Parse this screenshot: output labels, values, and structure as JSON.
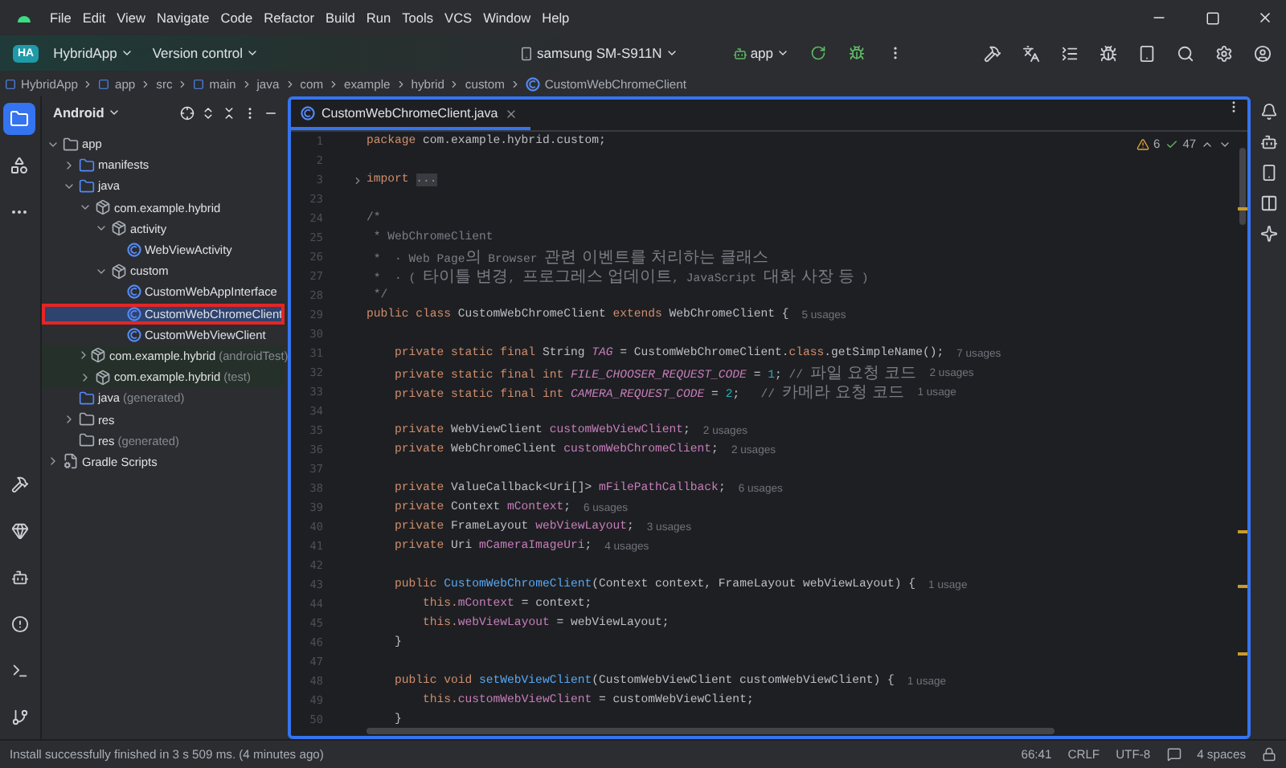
{
  "menu": [
    "File",
    "Edit",
    "View",
    "Navigate",
    "Code",
    "Refactor",
    "Build",
    "Run",
    "Tools",
    "VCS",
    "Window",
    "Help"
  ],
  "project": {
    "badge": "HA",
    "name": "HybridApp"
  },
  "version_control": "Version control",
  "device": "samsung SM-S911N",
  "run_config": "app",
  "breadcrumbs": [
    {
      "label": "HybridApp",
      "kind": "module"
    },
    {
      "label": "app",
      "kind": "module"
    },
    {
      "label": "src",
      "kind": "dir"
    },
    {
      "label": "main",
      "kind": "module"
    },
    {
      "label": "java",
      "kind": "dir"
    },
    {
      "label": "com",
      "kind": "dir"
    },
    {
      "label": "example",
      "kind": "dir"
    },
    {
      "label": "hybrid",
      "kind": "dir"
    },
    {
      "label": "custom",
      "kind": "dir"
    },
    {
      "label": "CustomWebChromeClient",
      "kind": "class"
    }
  ],
  "project_panel": {
    "view": "Android",
    "tree": [
      {
        "label": "app",
        "kind": "module",
        "expanded": true,
        "selected": false,
        "children": [
          {
            "label": "manifests",
            "kind": "folder",
            "expanded": false,
            "selected": false
          },
          {
            "label": "java",
            "kind": "folder",
            "expanded": true,
            "selected": false,
            "children": [
              {
                "label": "com.example.hybrid",
                "kind": "package",
                "expanded": true,
                "selected": false,
                "children": [
                  {
                    "label": "activity",
                    "kind": "package",
                    "expanded": true,
                    "selected": false,
                    "children": [
                      {
                        "label": "WebViewActivity",
                        "kind": "class",
                        "selected": false
                      }
                    ]
                  },
                  {
                    "label": "custom",
                    "kind": "package",
                    "expanded": true,
                    "selected": false,
                    "children": [
                      {
                        "label": "CustomWebAppInterface",
                        "kind": "class",
                        "selected": false
                      },
                      {
                        "label": "CustomWebChromeClient",
                        "kind": "class",
                        "selected": true
                      },
                      {
                        "label": "CustomWebViewClient",
                        "kind": "class",
                        "selected": false
                      }
                    ]
                  }
                ]
              },
              {
                "label": "com.example.hybrid",
                "suffix": "(androidTest)",
                "kind": "test-package",
                "expanded": false,
                "selected": false
              },
              {
                "label": "com.example.hybrid",
                "suffix": "(test)",
                "kind": "test-package",
                "expanded": false,
                "selected": false
              }
            ]
          },
          {
            "label": "java",
            "suffix": "(generated)",
            "kind": "generated",
            "selected": false
          },
          {
            "label": "res",
            "kind": "res",
            "expanded": false,
            "selected": false
          },
          {
            "label": "res",
            "suffix": "(generated)",
            "kind": "res",
            "selected": false
          }
        ]
      },
      {
        "label": "Gradle Scripts",
        "kind": "gradle",
        "expanded": false,
        "selected": false
      }
    ]
  },
  "editor": {
    "tab": {
      "label": "CustomWebChromeClient.java",
      "selected": true
    },
    "warnings": "6",
    "checks": "47",
    "lines": [
      {
        "number": "1",
        "tokens": [
          {
            "kind": "kw",
            "text": "package"
          },
          {
            "kind": "plain",
            "text": " com.example.hybrid.custom;"
          }
        ]
      },
      {
        "number": "2"
      },
      {
        "number": "3",
        "folded": true,
        "tokens": [
          {
            "kind": "kw",
            "text": "import "
          },
          {
            "kind": "fold",
            "text": "..."
          }
        ]
      },
      {
        "number": "23"
      },
      {
        "number": "24",
        "tokens": [
          {
            "kind": "comment",
            "text": "/*"
          }
        ]
      },
      {
        "number": "25",
        "tokens": [
          {
            "kind": "comment",
            "text": " * WebChromeClient"
          }
        ]
      },
      {
        "number": "26",
        "tokens": [
          {
            "kind": "comment",
            "text": " *  · Web Page의 Browser 관련 이벤트를 처리하는 클래스"
          }
        ]
      },
      {
        "number": "27",
        "tokens": [
          {
            "kind": "comment",
            "text": " *  · ( 타이틀 변경, 프로그레스 업데이트, JavaScript 대화 사장 등 )"
          }
        ]
      },
      {
        "number": "28",
        "tokens": [
          {
            "kind": "comment",
            "text": " */"
          }
        ]
      },
      {
        "number": "29",
        "tokens": [
          {
            "kind": "kw",
            "text": "public class "
          },
          {
            "kind": "plain",
            "text": "CustomWebChromeClient "
          },
          {
            "kind": "kw",
            "text": "extends "
          },
          {
            "kind": "plain",
            "text": "WebChromeClient {"
          }
        ],
        "hint": "5 usages"
      },
      {
        "number": "30"
      },
      {
        "number": "31",
        "tokens": [
          {
            "kind": "kw",
            "text": "    private static final "
          },
          {
            "kind": "plain",
            "text": "String "
          },
          {
            "kind": "const",
            "text": "TAG"
          },
          {
            "kind": "plain",
            "text": " = CustomWebChromeClient."
          },
          {
            "kind": "kw",
            "text": "class"
          },
          {
            "kind": "plain",
            "text": ".getSimpleName();"
          }
        ],
        "hint": "7 usages"
      },
      {
        "number": "32",
        "tokens": [
          {
            "kind": "kw",
            "text": "    private static final int "
          },
          {
            "kind": "const",
            "text": "FILE_CHOOSER_REQUEST_CODE"
          },
          {
            "kind": "plain",
            "text": " = "
          },
          {
            "kind": "num",
            "text": "1"
          },
          {
            "kind": "plain",
            "text": "; "
          },
          {
            "kind": "comment",
            "text": "// 파일 요청 코드"
          }
        ],
        "hint": "2 usages"
      },
      {
        "number": "33",
        "tokens": [
          {
            "kind": "kw",
            "text": "    private static final int "
          },
          {
            "kind": "const",
            "text": "CAMERA_REQUEST_CODE"
          },
          {
            "kind": "plain",
            "text": " = "
          },
          {
            "kind": "num",
            "text": "2"
          },
          {
            "kind": "plain",
            "text": ";   "
          },
          {
            "kind": "comment",
            "text": "// 카메라 요청 코드"
          }
        ],
        "hint": "1 usage"
      },
      {
        "number": "34"
      },
      {
        "number": "35",
        "tokens": [
          {
            "kind": "kw",
            "text": "    private "
          },
          {
            "kind": "plain",
            "text": "WebViewClient "
          },
          {
            "kind": "field",
            "text": "customWebViewClient"
          },
          {
            "kind": "plain",
            "text": ";"
          }
        ],
        "hint": "2 usages"
      },
      {
        "number": "36",
        "tokens": [
          {
            "kind": "kw",
            "text": "    private "
          },
          {
            "kind": "plain",
            "text": "WebChromeClient "
          },
          {
            "kind": "field",
            "text": "customWebChromeClient"
          },
          {
            "kind": "plain",
            "text": ";"
          }
        ],
        "hint": "2 usages"
      },
      {
        "number": "37"
      },
      {
        "number": "38",
        "tokens": [
          {
            "kind": "kw",
            "text": "    private "
          },
          {
            "kind": "plain",
            "text": "ValueCallback<Uri[]> "
          },
          {
            "kind": "field",
            "text": "mFilePathCallback"
          },
          {
            "kind": "plain",
            "text": ";"
          }
        ],
        "hint": "6 usages"
      },
      {
        "number": "39",
        "tokens": [
          {
            "kind": "kw",
            "text": "    private "
          },
          {
            "kind": "plain",
            "text": "Context "
          },
          {
            "kind": "field",
            "text": "mContext"
          },
          {
            "kind": "plain",
            "text": ";"
          }
        ],
        "hint": "6 usages"
      },
      {
        "number": "40",
        "tokens": [
          {
            "kind": "kw",
            "text": "    private "
          },
          {
            "kind": "plain",
            "text": "FrameLayout "
          },
          {
            "kind": "field",
            "text": "webViewLayout"
          },
          {
            "kind": "plain",
            "text": ";"
          }
        ],
        "hint": "3 usages"
      },
      {
        "number": "41",
        "tokens": [
          {
            "kind": "kw",
            "text": "    private "
          },
          {
            "kind": "plain",
            "text": "Uri "
          },
          {
            "kind": "field",
            "text": "mCameraImageUri"
          },
          {
            "kind": "plain",
            "text": ";"
          }
        ],
        "hint": "4 usages"
      },
      {
        "number": "42"
      },
      {
        "number": "43",
        "tokens": [
          {
            "kind": "kw",
            "text": "    public "
          },
          {
            "kind": "fn",
            "text": "CustomWebChromeClient"
          },
          {
            "kind": "plain",
            "text": "(Context context, FrameLayout webViewLayout) {"
          }
        ],
        "hint": "1 usage"
      },
      {
        "number": "44",
        "tokens": [
          {
            "kind": "kw",
            "text": "        this."
          },
          {
            "kind": "field",
            "text": "mContext"
          },
          {
            "kind": "plain",
            "text": " = context;"
          }
        ]
      },
      {
        "number": "45",
        "tokens": [
          {
            "kind": "kw",
            "text": "        this."
          },
          {
            "kind": "field",
            "text": "webViewLayout"
          },
          {
            "kind": "plain",
            "text": " = webViewLayout;"
          }
        ]
      },
      {
        "number": "46",
        "tokens": [
          {
            "kind": "plain",
            "text": "    }"
          }
        ]
      },
      {
        "number": "47"
      },
      {
        "number": "48",
        "tokens": [
          {
            "kind": "kw",
            "text": "    public void "
          },
          {
            "kind": "fn",
            "text": "setWebViewClient"
          },
          {
            "kind": "plain",
            "text": "(CustomWebViewClient customWebViewClient) {"
          }
        ],
        "hint": "1 usage"
      },
      {
        "number": "49",
        "tokens": [
          {
            "kind": "kw",
            "text": "        this."
          },
          {
            "kind": "field",
            "text": "customWebViewClient"
          },
          {
            "kind": "plain",
            "text": " = customWebViewClient;"
          }
        ]
      },
      {
        "number": "50",
        "tokens": [
          {
            "kind": "plain",
            "text": "    }"
          }
        ]
      }
    ]
  },
  "status_bar": {
    "message": "Install successfully finished in 3 s 509 ms. (4 minutes ago)",
    "position": "66:41",
    "line_separator": "CRLF",
    "encoding": "UTF-8",
    "indent": "4 spaces"
  }
}
